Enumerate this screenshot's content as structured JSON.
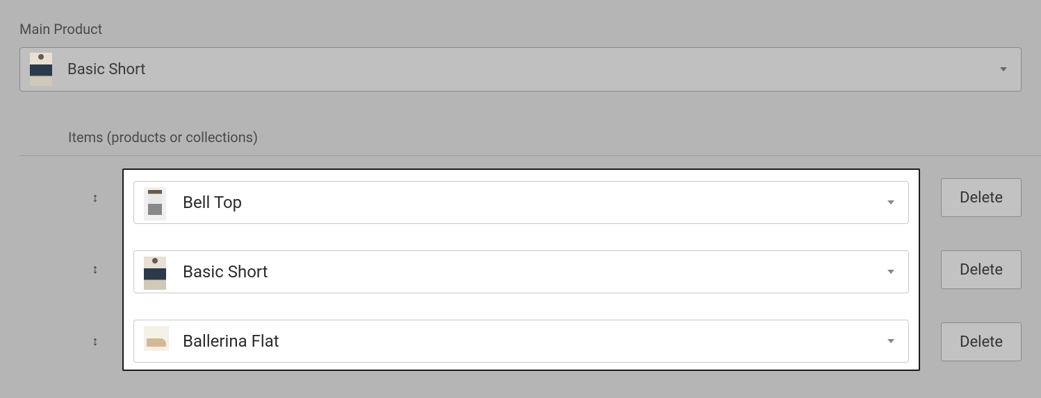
{
  "mainProduct": {
    "label": "Main Product",
    "selected": "Basic Short"
  },
  "itemsSection": {
    "label": "Items (products or collections)",
    "deleteLabel": "Delete",
    "rows": [
      {
        "name": "Bell Top"
      },
      {
        "name": "Basic Short"
      },
      {
        "name": "Ballerina Flat"
      }
    ]
  }
}
